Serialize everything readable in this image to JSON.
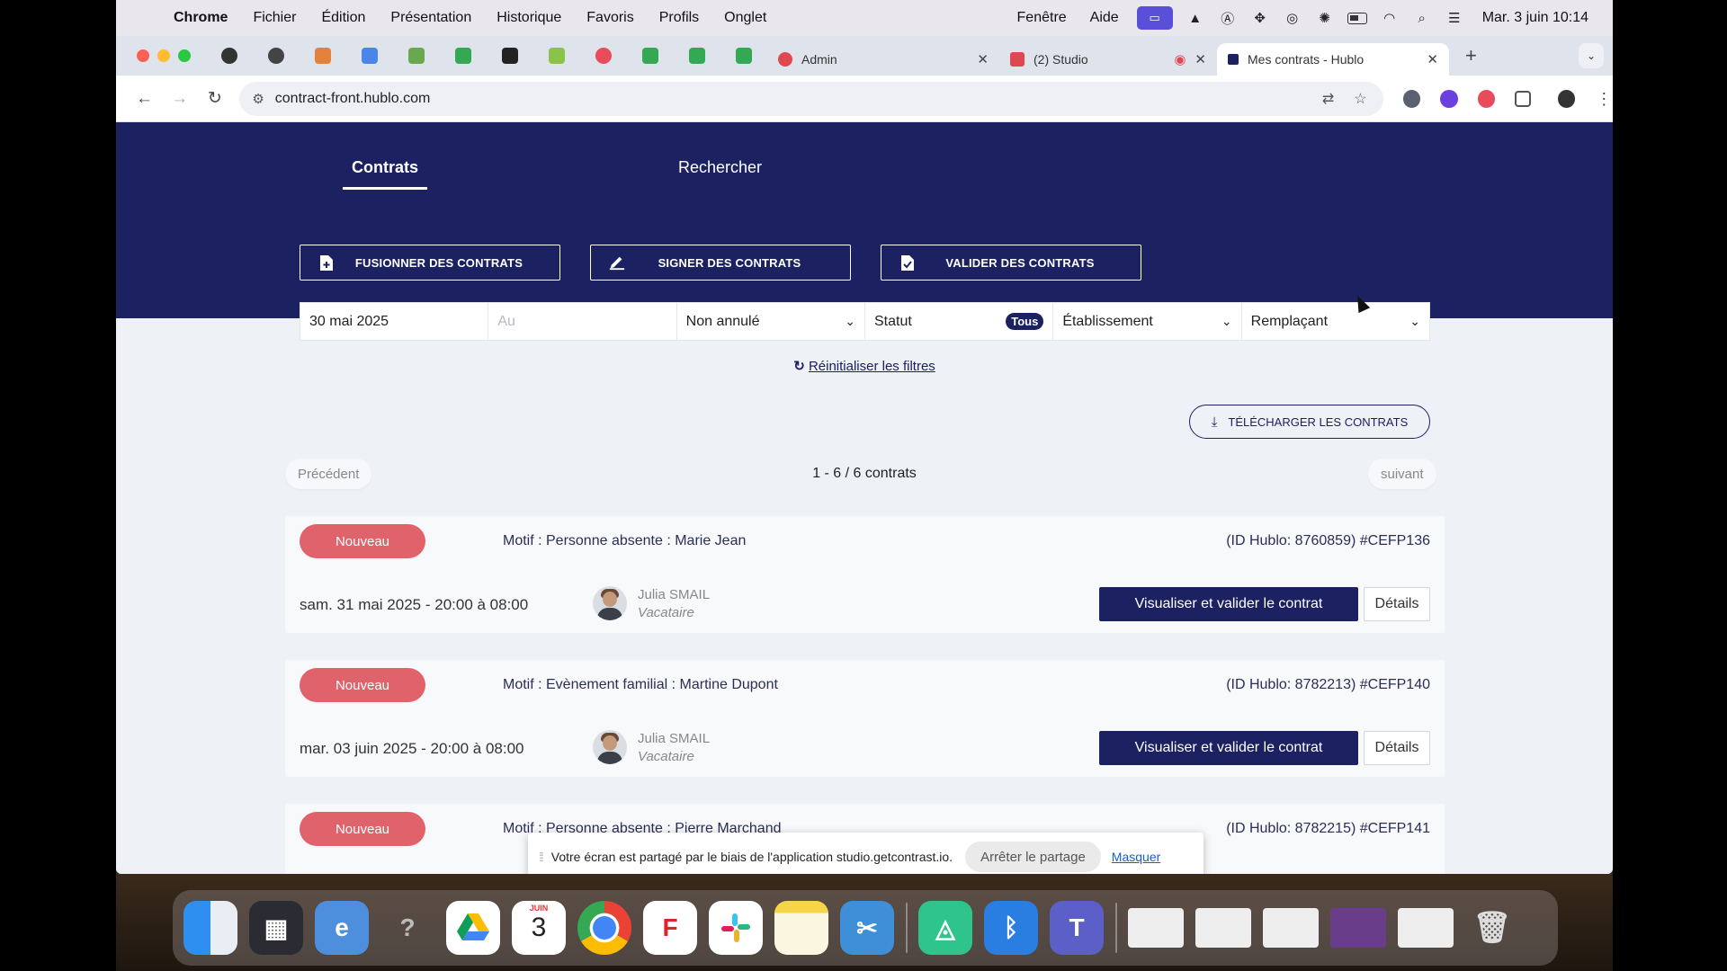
{
  "menubar": {
    "app": "Chrome",
    "items": [
      "Fichier",
      "Édition",
      "Présentation",
      "Historique",
      "Favoris",
      "Profils",
      "Onglet"
    ],
    "right_items": [
      "Fenêtre",
      "Aide"
    ],
    "clock": "Mar. 3 juin  10:14"
  },
  "tabs": {
    "admin": "Admin",
    "studio": "(2) Studio",
    "active": "Mes contrats - Hublo"
  },
  "toolbar": {
    "url": "contract-front.hublo.com"
  },
  "nav": {
    "contracts": "Contrats",
    "search": "Rechercher"
  },
  "actions": {
    "merge": "FUSIONNER DES CONTRATS",
    "sign": "SIGNER DES CONTRATS",
    "validate": "VALIDER DES CONTRATS"
  },
  "filters": {
    "from_date": "30 mai 2025",
    "to_placeholder": "Au",
    "cancel_state": "Non annulé",
    "status": "Statut",
    "status_pill": "Tous",
    "establishment": "Établissement",
    "replacement": "Remplaçant"
  },
  "reset_label": "Réinitialiser les filtres",
  "download_label": "TÉLÉCHARGER LES CONTRATS",
  "pager": {
    "prev": "Précédent",
    "next": "suivant",
    "count": "1 - 6 / 6 contrats"
  },
  "contracts": [
    {
      "badge": "Nouveau",
      "motif": "Motif : Personne absente : Marie Jean",
      "hublo_id": "(ID Hublo: 8760859) #CEFP136",
      "date": "sam. 31 mai 2025 - 20:00 à 08:00",
      "person": "Julia SMAIL",
      "role": "Vacataire",
      "view_label": "Visualiser et valider le contrat",
      "details_label": "Détails"
    },
    {
      "badge": "Nouveau",
      "motif": "Motif : Evènement familial : Martine Dupont",
      "hublo_id": "(ID Hublo: 8782213) #CEFP140",
      "date": "mar. 03 juin 2025 - 20:00 à 08:00",
      "person": "Julia SMAIL",
      "role": "Vacataire",
      "view_label": "Visualiser et valider le contrat",
      "details_label": "Détails"
    },
    {
      "badge": "Nouveau",
      "motif": "Motif : Personne absente : Pierre Marchand",
      "hublo_id": "(ID Hublo: 8782215) #CEFP141"
    }
  ],
  "share": {
    "message": "Votre écran est partagé par le biais de l'application studio.getcontrast.io.",
    "stop": "Arrêter le partage",
    "hide": "Masquer"
  },
  "dock": {
    "calendar_month": "JUIN",
    "calendar_day": "3"
  },
  "colors": {
    "brand_navy": "#1c2161",
    "badge_new": "#e0636b",
    "page_bg": "#eef1f6"
  }
}
